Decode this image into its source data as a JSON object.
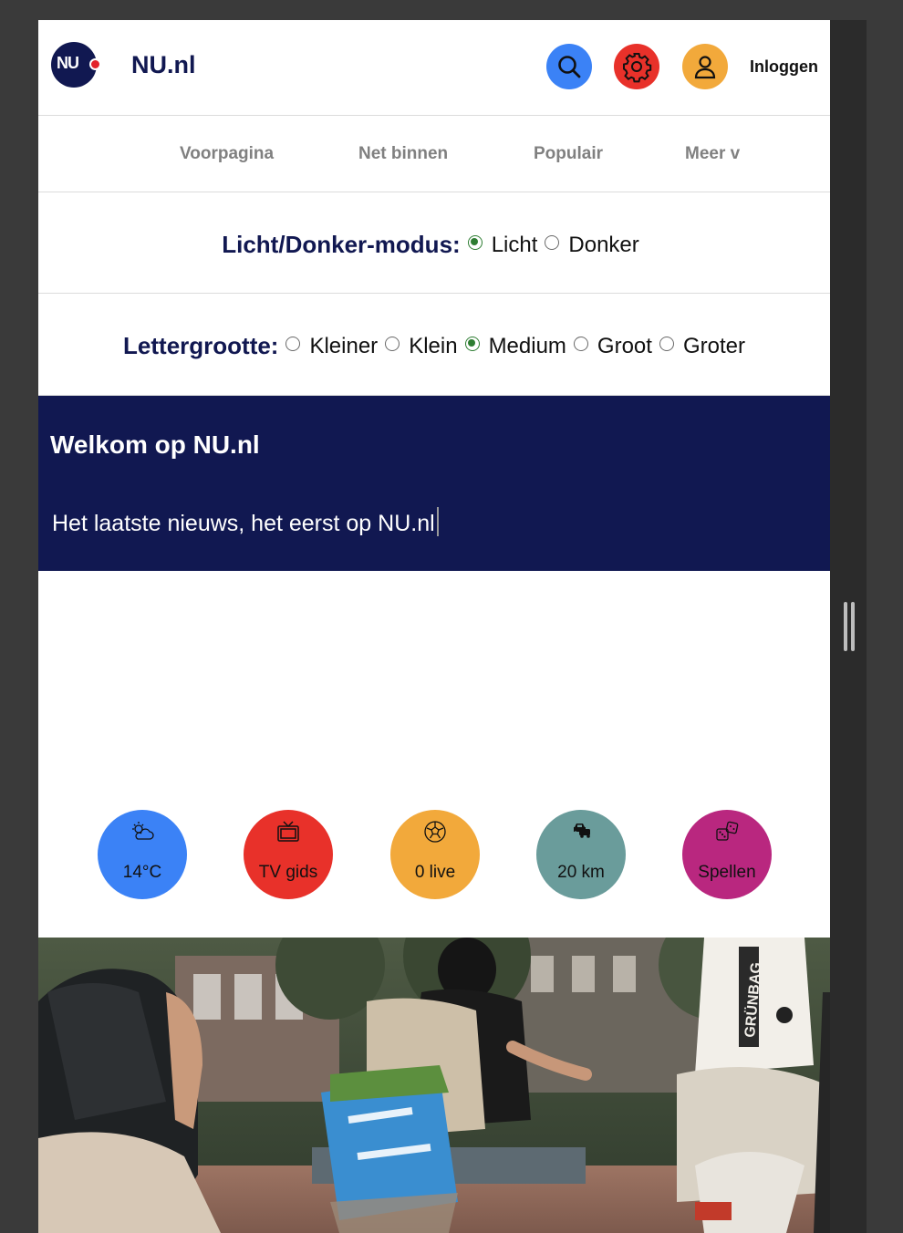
{
  "header": {
    "logo_text": "NU",
    "site_name": "NU.nl",
    "search_icon": "search-icon",
    "settings_icon": "gear-icon",
    "user_icon": "user-icon",
    "login_label": "Inloggen",
    "colors": {
      "brand": "#111851",
      "search": "#3b82f6",
      "settings": "#e8312a",
      "user": "#f2a93b"
    }
  },
  "nav": {
    "items": [
      {
        "label": "Voorpagina"
      },
      {
        "label": "Net binnen"
      },
      {
        "label": "Populair"
      },
      {
        "label": "Meer v"
      }
    ]
  },
  "mode": {
    "label": "Licht/Donker-modus:",
    "options": [
      {
        "label": "Licht",
        "checked": true
      },
      {
        "label": "Donker",
        "checked": false
      }
    ]
  },
  "font_size": {
    "label": "Lettergrootte:",
    "options": [
      {
        "label": "Kleiner",
        "checked": false
      },
      {
        "label": "Klein",
        "checked": false
      },
      {
        "label": "Medium",
        "checked": true
      },
      {
        "label": "Groot",
        "checked": false
      },
      {
        "label": "Groter",
        "checked": false
      }
    ]
  },
  "banner": {
    "title": "Welkom op NU.nl",
    "input_value": "Het laatste nieuws, het eerst op NU.nl",
    "background": "#111851"
  },
  "quick_links": [
    {
      "label": "14°C",
      "icon": "weather-icon",
      "color": "#3b82f6"
    },
    {
      "label": "TV gids",
      "icon": "tv-icon",
      "color": "#e8312a"
    },
    {
      "label": "0 live",
      "icon": "football-icon",
      "color": "#f2a93b"
    },
    {
      "label": "20 km",
      "icon": "traffic-icon",
      "color": "#6a9c9b"
    },
    {
      "label": "Spellen",
      "icon": "dice-icon",
      "color": "#b9277f"
    }
  ],
  "photo": {
    "backpack_text": "GRÜNBAG"
  }
}
